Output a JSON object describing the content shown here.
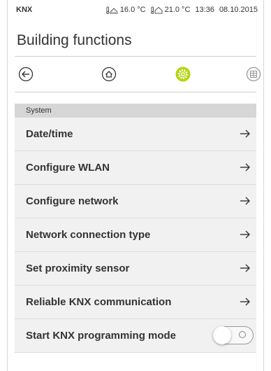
{
  "status_bar": {
    "brand": "KNX",
    "outdoor_temp": "16.0 °C",
    "indoor_temp": "21.0 °C",
    "time": "13:36",
    "date": "08.10.2015"
  },
  "page_title": "Building functions",
  "nav": {
    "icons": [
      "back-arrow-icon",
      "home-icon",
      "gear-icon",
      "grid-icon"
    ],
    "accent_color": "#b4d40f"
  },
  "section": {
    "label": "System"
  },
  "items": [
    {
      "label": "Date/time",
      "control": "arrow"
    },
    {
      "label": "Configure WLAN",
      "control": "arrow"
    },
    {
      "label": "Configure network",
      "control": "arrow"
    },
    {
      "label": "Network connection type",
      "control": "arrow"
    },
    {
      "label": "Set proximity sensor",
      "control": "arrow"
    },
    {
      "label": "Reliable KNX communication",
      "control": "arrow"
    },
    {
      "label": "Start KNX programming mode",
      "control": "toggle",
      "state": "off"
    }
  ]
}
